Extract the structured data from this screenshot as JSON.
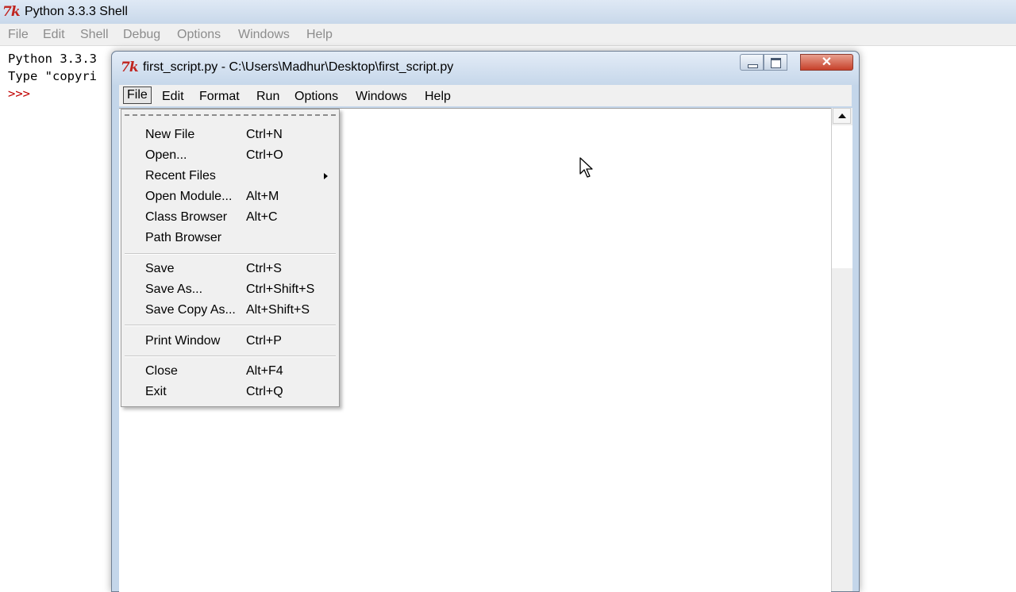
{
  "shell": {
    "title": "Python 3.3.3 Shell",
    "menu": [
      "File",
      "Edit",
      "Shell",
      "Debug",
      "Options",
      "Windows",
      "Help"
    ],
    "lines": [
      "Python 3.3.3",
      "Type \"copyri"
    ],
    "prompt": ">>>"
  },
  "editor": {
    "title": "first_script.py - C:\\Users\\Madhur\\Desktop\\first_script.py",
    "close_glyph": "✕",
    "menu": [
      "File",
      "Edit",
      "Format",
      "Run",
      "Options",
      "Windows",
      "Help"
    ]
  },
  "file_menu": {
    "items": [
      {
        "label": "New File",
        "accel": "Ctrl+N"
      },
      {
        "label": "Open...",
        "accel": "Ctrl+O"
      },
      {
        "label": "Recent Files",
        "accel": ""
      },
      {
        "label": "Open Module...",
        "accel": "Alt+M"
      },
      {
        "label": "Class Browser",
        "accel": "Alt+C"
      },
      {
        "label": "Path Browser",
        "accel": ""
      },
      {
        "label": "Save",
        "accel": "Ctrl+S"
      },
      {
        "label": "Save As...",
        "accel": "Ctrl+Shift+S"
      },
      {
        "label": "Save Copy As...",
        "accel": "Alt+Shift+S"
      },
      {
        "label": "Print Window",
        "accel": "Ctrl+P"
      },
      {
        "label": "Close",
        "accel": "Alt+F4"
      },
      {
        "label": "Exit",
        "accel": "Ctrl+Q"
      }
    ]
  },
  "colors": {
    "titlebar": "#c6d7ea",
    "close_button": "#c7402a",
    "prompt": "#c00000",
    "menu_bg": "#f0f0f0"
  }
}
